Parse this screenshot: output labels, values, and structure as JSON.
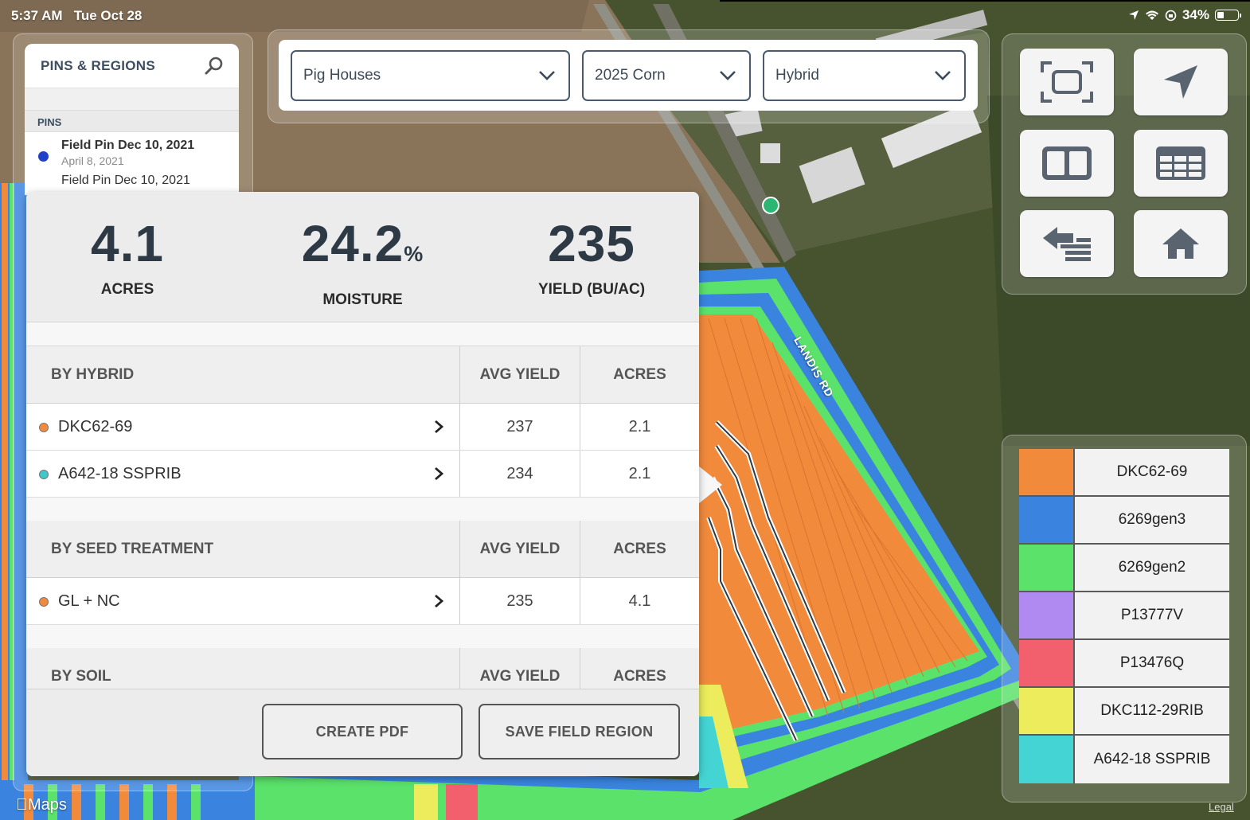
{
  "status_bar": {
    "time": "5:37 AM",
    "date": "Tue Oct 28",
    "battery": "34%"
  },
  "pins_panel": {
    "title": "PINS & REGIONS",
    "section": "PINS",
    "pins": [
      {
        "name": "Field Pin Dec 10, 2021",
        "date": "April 8, 2021"
      }
    ],
    "partial_row": "Field Pin Dec 10, 2021"
  },
  "selectors": {
    "farm": "Pig Houses",
    "season": "2025 Corn",
    "layer": "Hybrid"
  },
  "tools": [
    "fit-to-screen-icon",
    "locate-icon",
    "split-view-icon",
    "table-view-icon",
    "swap-layers-icon",
    "home-icon"
  ],
  "summary": {
    "acres": {
      "value": "4.1",
      "label": "ACRES"
    },
    "moisture": {
      "value": "24.2",
      "unit": "%",
      "label": "MOISTURE"
    },
    "yield": {
      "value": "235",
      "label": "YIELD (BU/AC)"
    }
  },
  "tables": {
    "hybrid": {
      "header": "BY HYBRID",
      "avg": "AVG YIELD",
      "acres": "ACRES",
      "rows": [
        {
          "name": "DKC62-69",
          "avg": "237",
          "acres": "2.1",
          "color": "#f28a3c"
        },
        {
          "name": "A642-18 SSPRIB",
          "avg": "234",
          "acres": "2.1",
          "color": "#3fc7c9"
        }
      ]
    },
    "seed_treatment": {
      "header": "BY SEED TREATMENT",
      "avg": "AVG YIELD",
      "acres": "ACRES",
      "rows": [
        {
          "name": "GL + NC",
          "avg": "235",
          "acres": "4.1",
          "color": "#f28a3c"
        }
      ]
    },
    "soil": {
      "header": "BY SOIL",
      "avg": "AVG YIELD",
      "acres": "ACRES"
    }
  },
  "buttons": {
    "create_pdf": "CREATE PDF",
    "save_region": "SAVE FIELD REGION"
  },
  "legend": [
    {
      "label": "DKC62-69",
      "color": "#f28a3c"
    },
    {
      "label": "6269gen3",
      "color": "#3a84e0"
    },
    {
      "label": "6269gen2",
      "color": "#5be26a"
    },
    {
      "label": "P13777V",
      "color": "#b08af0"
    },
    {
      "label": "P13476Q",
      "color": "#f2606e"
    },
    {
      "label": "DKC112-29RIB",
      "color": "#ecec5c"
    },
    {
      "label": "A642-18 SSPRIB",
      "color": "#44d4d4"
    }
  ],
  "map": {
    "road_label": "LANDIS RD",
    "maps_logo": "Maps",
    "legal": "Legal"
  }
}
